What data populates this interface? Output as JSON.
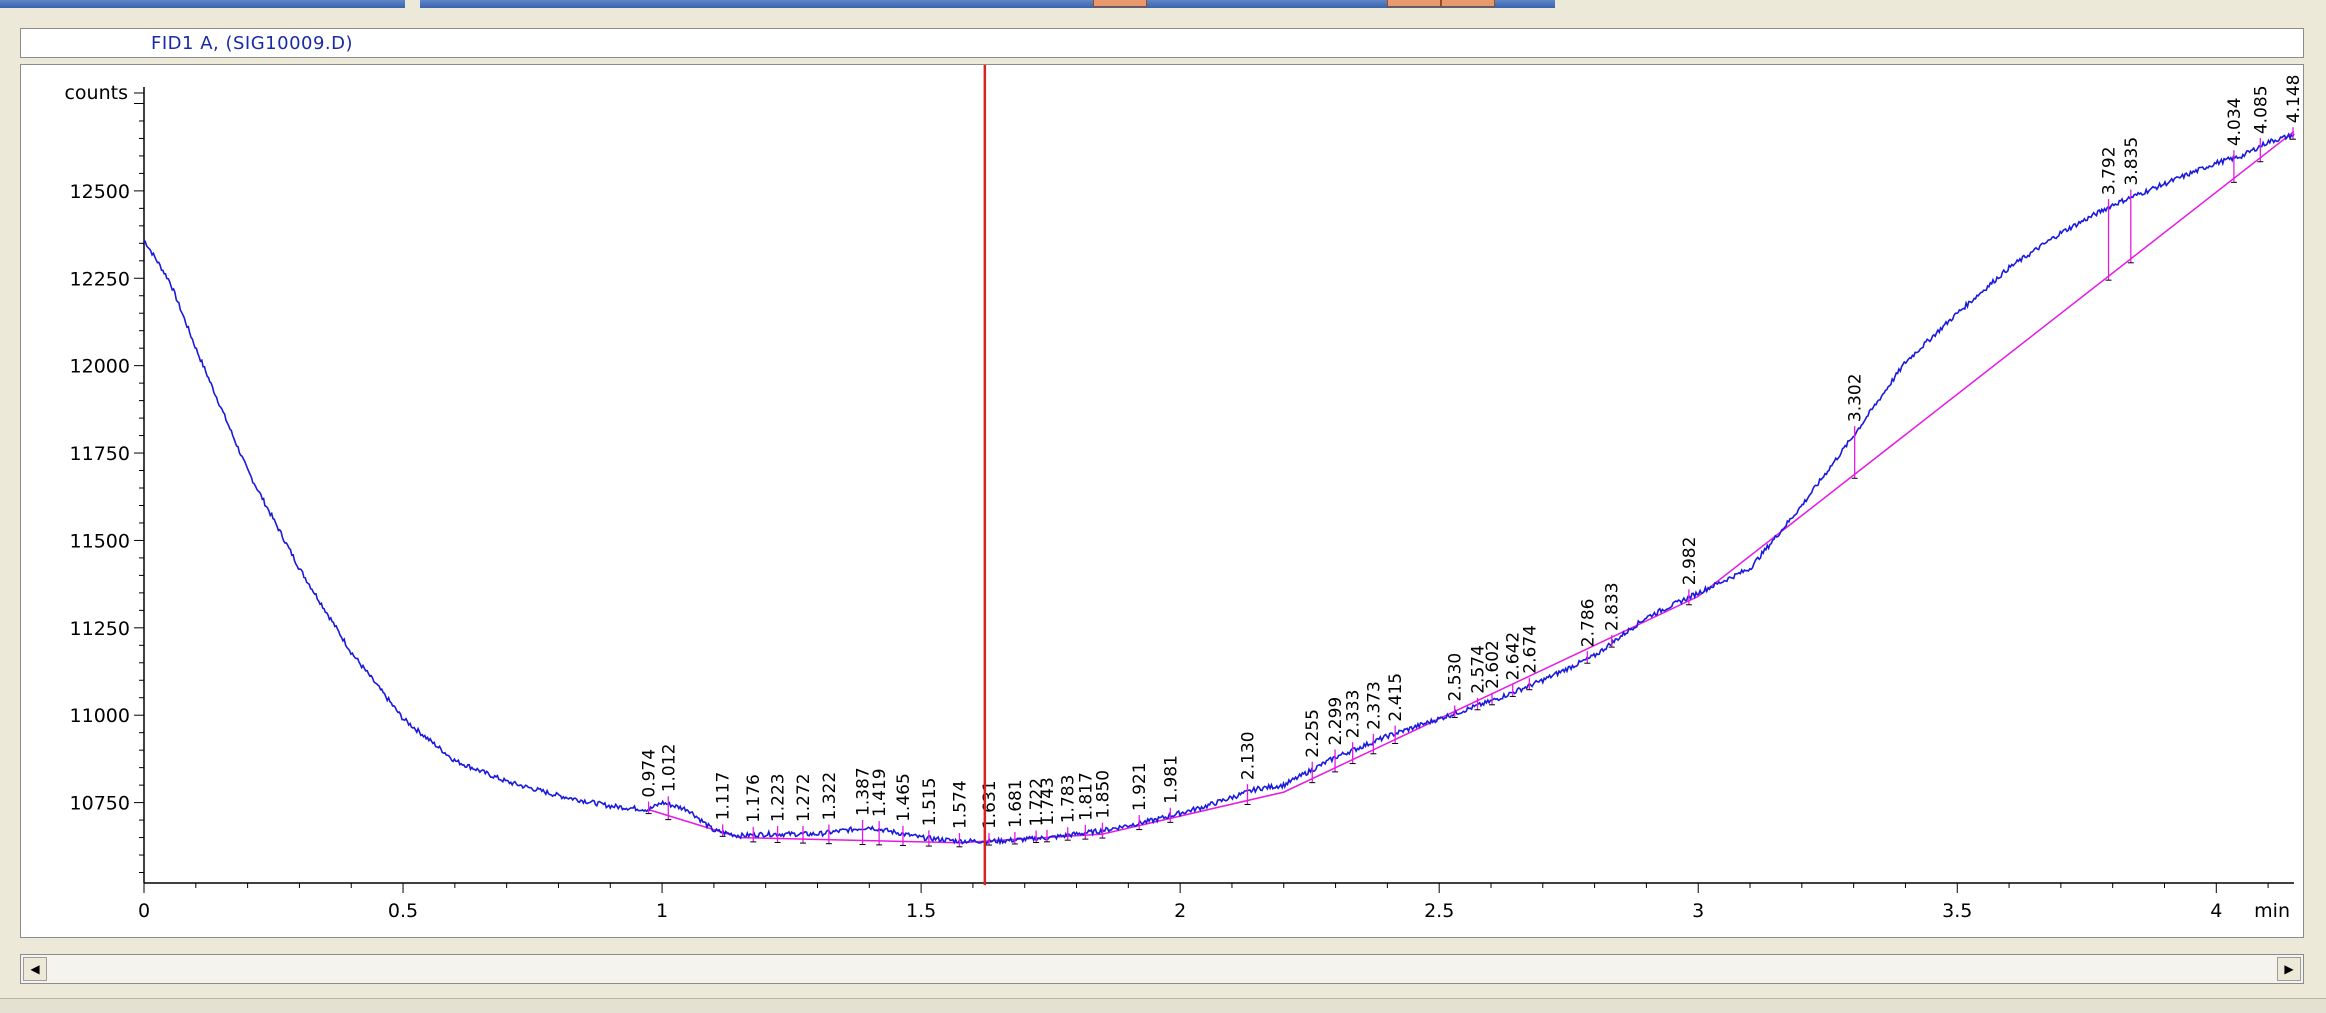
{
  "window": {
    "signal_title": "FID1 A,  (SIG10009.D)"
  },
  "icons": {
    "scroll_left": "◀",
    "scroll_right": "▶"
  },
  "colors": {
    "signal": "#1a1adb",
    "baseline": "#e619e6",
    "cursor": "#d8241c",
    "title_text": "#1a2aa8"
  },
  "chart_data": {
    "type": "line",
    "xlabel": "min",
    "ylabel": "counts",
    "xlim": [
      0,
      4.15
    ],
    "ylim": [
      10520,
      12780
    ],
    "x_ticks": [
      "0",
      "0.5",
      "1",
      "1.5",
      "2",
      "2.5",
      "3",
      "3.5",
      "4"
    ],
    "x_tick_values": [
      0,
      0.5,
      1,
      1.5,
      2,
      2.5,
      3,
      3.5,
      4
    ],
    "y_ticks": [
      "10750",
      "11000",
      "11250",
      "11500",
      "11750",
      "12000",
      "12250",
      "12500"
    ],
    "y_tick_values": [
      10750,
      11000,
      11250,
      11500,
      11750,
      12000,
      12250,
      12500
    ],
    "cursor_x": 1.623,
    "series": [
      {
        "x": [
          0,
          0.05,
          0.1,
          0.2,
          0.3,
          0.4,
          0.5,
          0.6,
          0.7,
          0.8,
          0.9,
          0.974,
          1.0,
          1.05,
          1.1,
          1.15,
          1.2,
          1.3,
          1.4,
          1.5,
          1.574,
          1.65,
          1.75,
          1.85,
          1.95,
          2.05,
          2.15,
          2.2,
          2.3,
          2.4,
          2.5,
          2.6,
          2.7,
          2.8,
          2.9,
          3.0,
          3.1,
          3.2,
          3.3,
          3.4,
          3.5,
          3.6,
          3.7,
          3.8,
          3.9,
          4.0,
          4.05,
          4.1,
          4.15
        ],
        "y": [
          12360,
          12240,
          12050,
          11700,
          11420,
          11180,
          10990,
          10870,
          10810,
          10770,
          10740,
          10730,
          10750,
          10730,
          10670,
          10655,
          10660,
          10660,
          10680,
          10650,
          10640,
          10640,
          10650,
          10670,
          10700,
          10740,
          10790,
          10800,
          10880,
          10940,
          10990,
          11040,
          11100,
          11170,
          11280,
          11350,
          11420,
          11600,
          11800,
          12010,
          12150,
          12280,
          12380,
          12460,
          12520,
          12580,
          12600,
          12640,
          12660
        ]
      }
    ],
    "baseline_segments": [
      {
        "x": [
          0.974,
          1.15,
          1.574,
          1.85,
          2.2,
          3.0,
          4.15
        ],
        "y": [
          10730,
          10650,
          10635,
          10660,
          10780,
          11340,
          12670
        ]
      }
    ],
    "peaks": [
      {
        "rt": "0.974",
        "x": 0.974
      },
      {
        "rt": "1.012",
        "x": 1.012
      },
      {
        "rt": "1.117",
        "x": 1.117
      },
      {
        "rt": "1.176",
        "x": 1.176
      },
      {
        "rt": "1.223",
        "x": 1.223
      },
      {
        "rt": "1.272",
        "x": 1.272
      },
      {
        "rt": "1.322",
        "x": 1.322
      },
      {
        "rt": "1.387",
        "x": 1.387
      },
      {
        "rt": "1.419",
        "x": 1.419
      },
      {
        "rt": "1.465",
        "x": 1.465
      },
      {
        "rt": "1.515",
        "x": 1.515
      },
      {
        "rt": "1.574",
        "x": 1.574
      },
      {
        "rt": "1.631",
        "x": 1.631
      },
      {
        "rt": "1.681",
        "x": 1.681
      },
      {
        "rt": "1.722",
        "x": 1.722
      },
      {
        "rt": "1.743",
        "x": 1.743
      },
      {
        "rt": "1.783",
        "x": 1.783
      },
      {
        "rt": "1.817",
        "x": 1.817
      },
      {
        "rt": "1.850",
        "x": 1.85
      },
      {
        "rt": "1.921",
        "x": 1.921
      },
      {
        "rt": "1.981",
        "x": 1.981
      },
      {
        "rt": "2.130",
        "x": 2.13
      },
      {
        "rt": "2.255",
        "x": 2.255
      },
      {
        "rt": "2.299",
        "x": 2.299
      },
      {
        "rt": "2.333",
        "x": 2.333
      },
      {
        "rt": "2.373",
        "x": 2.373
      },
      {
        "rt": "2.415",
        "x": 2.415
      },
      {
        "rt": "2.530",
        "x": 2.53
      },
      {
        "rt": "2.574",
        "x": 2.574
      },
      {
        "rt": "2.602",
        "x": 2.602
      },
      {
        "rt": "2.642",
        "x": 2.642
      },
      {
        "rt": "2.674",
        "x": 2.674
      },
      {
        "rt": "2.786",
        "x": 2.786
      },
      {
        "rt": "2.833",
        "x": 2.833
      },
      {
        "rt": "2.982",
        "x": 2.982
      },
      {
        "rt": "3.302",
        "x": 3.302
      },
      {
        "rt": "3.792",
        "x": 3.792
      },
      {
        "rt": "3.835",
        "x": 3.835
      },
      {
        "rt": "4.034",
        "x": 4.034
      },
      {
        "rt": "4.085",
        "x": 4.085
      },
      {
        "rt": "4.148",
        "x": 4.148
      }
    ]
  }
}
